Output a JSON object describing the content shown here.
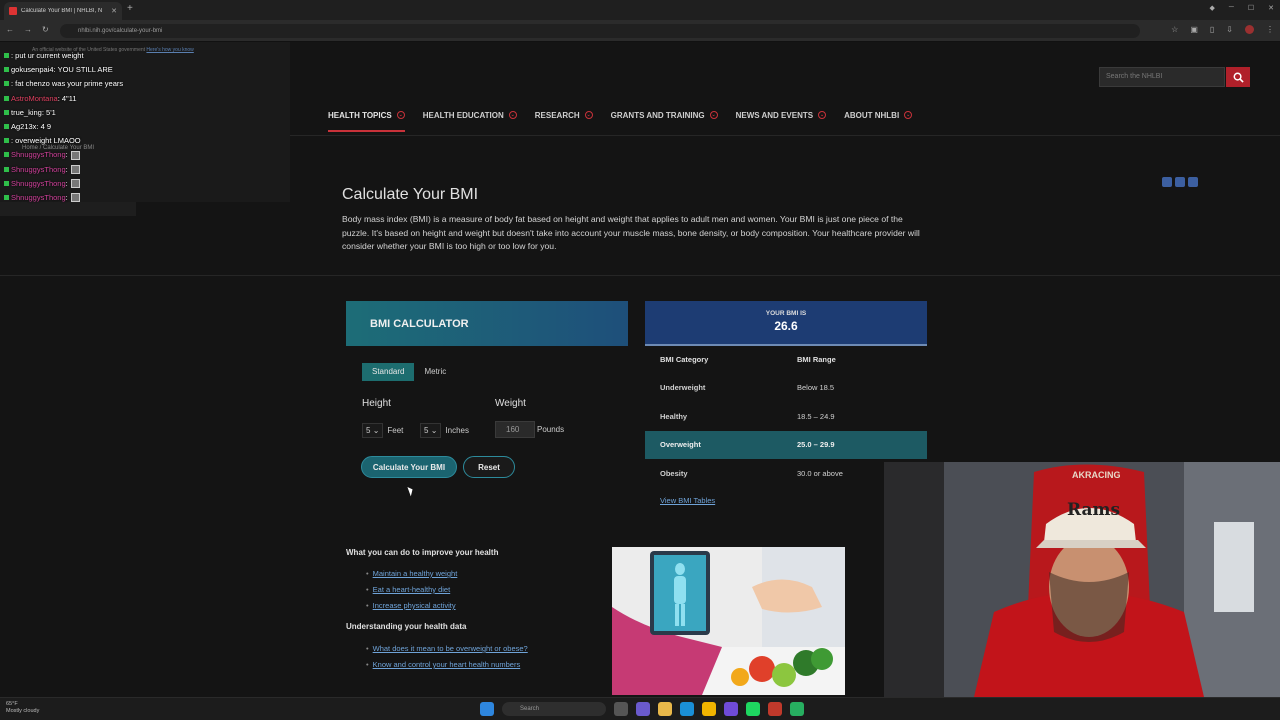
{
  "browser": {
    "tab_title": "Calculate Your BMI | NHLBI, N",
    "url": "nhlbi.nih.gov/calculate-your-bmi"
  },
  "gov_banner": {
    "text": "An official website of the United States government",
    "link": "Here's how you know"
  },
  "breadcrumb": "Home  /  Calculate Your BMI",
  "chat": [
    {
      "user": "",
      "message": ": put ur current weight",
      "color": "#e0404a"
    },
    {
      "user": "gokusenpai4",
      "message": ": YOU STILL ARE",
      "color": "#ffffff"
    },
    {
      "user": "",
      "message": ": fat chenzo was your prime years",
      "color": "#e0404a"
    },
    {
      "user": "AstroMontana",
      "message": ": 4\"11",
      "color": "#e04060"
    },
    {
      "user": "true_king",
      "message": ": 5'1",
      "color": "#ffffff"
    },
    {
      "user": "Ag213x",
      "message": ": 4 9",
      "color": "#ffffff"
    },
    {
      "user": "",
      "message": ": overweight LMAOO",
      "color": "#e0404a"
    },
    {
      "user": "ShnuggysThong",
      "message": ":",
      "color": "#d0409a"
    },
    {
      "user": "ShnuggysThong",
      "message": ":",
      "color": "#d0409a"
    },
    {
      "user": "ShnuggysThong",
      "message": ":",
      "color": "#d0409a"
    },
    {
      "user": "ShnuggysThong",
      "message": ":",
      "color": "#d0409a"
    }
  ],
  "search": {
    "placeholder": "Search the NHLBI"
  },
  "nav": [
    {
      "label": "HEALTH TOPICS"
    },
    {
      "label": "HEALTH EDUCATION"
    },
    {
      "label": "RESEARCH"
    },
    {
      "label": "GRANTS AND TRAINING"
    },
    {
      "label": "NEWS AND EVENTS"
    },
    {
      "label": "ABOUT NHLBI"
    }
  ],
  "page": {
    "title": "Calculate Your BMI",
    "intro": "Body mass index (BMI) is a measure of body fat based on height and weight that applies to adult men and women. Your BMI is just one piece of the puzzle. It's based on height and weight but doesn't take into account your muscle mass, bone density, or body composition. Your healthcare provider will consider whether your BMI is too high or too low for you."
  },
  "calculator": {
    "title": "BMI CALCULATOR",
    "tab_standard": "Standard",
    "tab_metric": "Metric",
    "height_label": "Height",
    "weight_label": "Weight",
    "feet_value": "5",
    "feet_label": "Feet",
    "inches_value": "5",
    "inches_label": "Inches",
    "weight_value": "160",
    "weight_unit": "Pounds",
    "calc_button": "Calculate Your BMI",
    "reset_button": "Reset"
  },
  "result": {
    "label": "YOUR BMI IS",
    "value": "26.6",
    "col_category": "BMI Category",
    "col_range": "BMI Range",
    "rows": [
      {
        "category": "Underweight",
        "range": "Below 18.5"
      },
      {
        "category": "Healthy",
        "range": "18.5 – 24.9"
      },
      {
        "category": "Overweight",
        "range": "25.0 – 29.9"
      },
      {
        "category": "Obesity",
        "range": "30.0 or above"
      }
    ],
    "tables_link": "View BMI Tables"
  },
  "improve": {
    "title": "What you can do to improve your health",
    "links": [
      "Maintain a healthy weight",
      "Eat a heart-healthy diet",
      "Increase physical activity"
    ]
  },
  "understand": {
    "title": "Understanding your health data",
    "links": [
      "What does it mean to be overweight or obese?",
      "Know and control your heart health numbers"
    ]
  },
  "webcam": {
    "cap_text": "Rams",
    "headrest_text": "AKRACING"
  },
  "taskbar": {
    "weather_temp": "65°F",
    "weather_desc": "Mostly cloudy",
    "search": "Search"
  },
  "colors": {
    "accent_red": "#c9323a",
    "calc_teal": "#1d6d77",
    "result_navy": "#1d3c73",
    "link_blue": "#6fa3d8"
  }
}
